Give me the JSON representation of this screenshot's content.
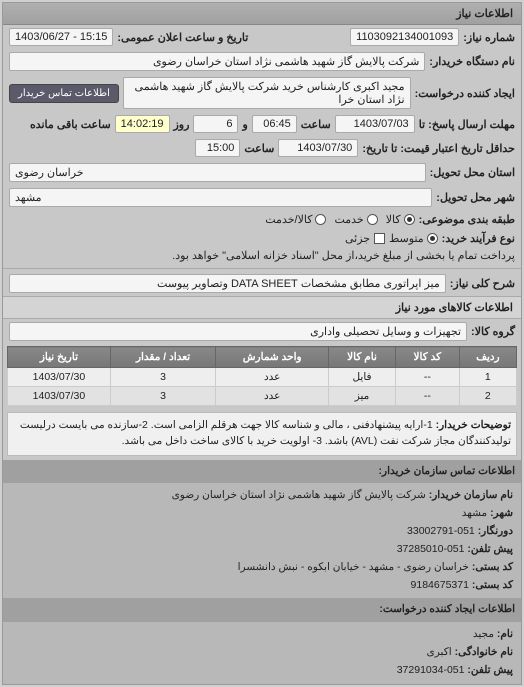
{
  "sections": {
    "info_title": "اطلاعات نیاز",
    "goods_title": "اطلاعات کالاهای مورد نیاز",
    "contact_buyer_title": "اطلاعات تماس سازمان خریدار:",
    "contact_creator_title": "اطلاعات ایجاد کننده درخواست:"
  },
  "labels": {
    "request_no": "شماره نیاز:",
    "announce_date": "تاریخ و ساعت اعلان عمومی:",
    "buyer_org": "نام دستگاه خریدار:",
    "creator": "ایجاد کننده درخواست:",
    "deadline_from": "مهلت ارسال پاسخ: تا",
    "time": "ساعت",
    "day": "و",
    "day2": "روز",
    "remaining": "ساعت باقی مانده",
    "price_validity": "حداقل تاریخ اعتبار قیمت: تا تاریخ:",
    "delivery_state": "استان محل تحویل:",
    "delivery_city": "شهر محل تحویل:",
    "subject_type": "طبقه بندی موضوعی:",
    "payment_type": "نوع فرآیند خرید:",
    "summary": "شرح کلی نیاز:",
    "group": "گروه کالا:",
    "notes": "توضیحات خریدار:",
    "radio_goods": "کالا",
    "radio_service": "خدمت",
    "radio_both": "کالا/خدمت",
    "radio_medium": "متوسط",
    "pay_note_prefix": "پرداخت تمام یا بخشی از مبلغ خرید،از محل \"اسناد خزانه اسلامی\" خواهد بود."
  },
  "values": {
    "request_no": "1103092134001093",
    "announce_date": "15:15 - 1403/06/27",
    "buyer_org": "شرکت پالایش گاز شهید هاشمی نژاد    استان خراسان رضوی",
    "creator": "مجید اکبری کارشناس خرید شرکت پالایش گاز شهید هاشمی نژاد    استان خرا",
    "deadline_date": "1403/07/03",
    "deadline_time": "06:45",
    "remaining_days": "6",
    "remaining_time": "14:02:19",
    "validity_date": "1403/07/30",
    "validity_time": "15:00",
    "delivery_state": "خراسان رضوی",
    "delivery_city": "مشهد",
    "partial": "جزئی",
    "summary": "میز اپراتوری مطابق مشخصات DATA SHEET وتصاویر پیوست",
    "group": "تجهیزات و وسایل تحصیلی واداری",
    "notes": "1-ارایه پیشنهادفنی ، مالی و شناسه کالا جهت هرقلم الزامی است. 2-سازنده می بایست درلیست تولیدکنندگان مجاز شرکت نفت (AVL) باشد. 3- اولویت خرید با کالای ساخت داخل می باشد."
  },
  "buttons": {
    "contact_buyer": "اطلاعات تماس خریدار"
  },
  "table": {
    "headers": [
      "ردیف",
      "کد کالا",
      "نام کالا",
      "واحد شمارش",
      "تعداد / مقدار",
      "تاریخ نیاز"
    ],
    "rows": [
      [
        "1",
        "--",
        "فایل",
        "عدد",
        "3",
        "1403/07/30"
      ],
      [
        "2",
        "--",
        "میز",
        "عدد",
        "3",
        "1403/07/30"
      ]
    ]
  },
  "contact": {
    "org_name_lbl": "نام سازمان خریدار:",
    "org_name": "شرکت پالایش گاز شهید هاشمی نژاد استان خراسان رضوی",
    "city_lbl": "شهر:",
    "city": "مشهد",
    "fax_lbl": "دورنگار:",
    "fax": "051-33002791",
    "phone_lbl": "پیش تلفن:",
    "phone": "051-37285010",
    "postal_addr_lbl": "کد بستی:",
    "postal_addr": "خراسان رضوی - مشهد - خیابان ابکوه - نبش دانشسرا",
    "postal_code_lbl": "کد بستی:",
    "postal_code": "9184675371",
    "name_lbl": "نام:",
    "name": "مجید",
    "lname_lbl": "نام خانوادگی:",
    "lname": "اکبری",
    "tel_lbl": "پیش تلفن:",
    "tel": "051-37291034"
  }
}
